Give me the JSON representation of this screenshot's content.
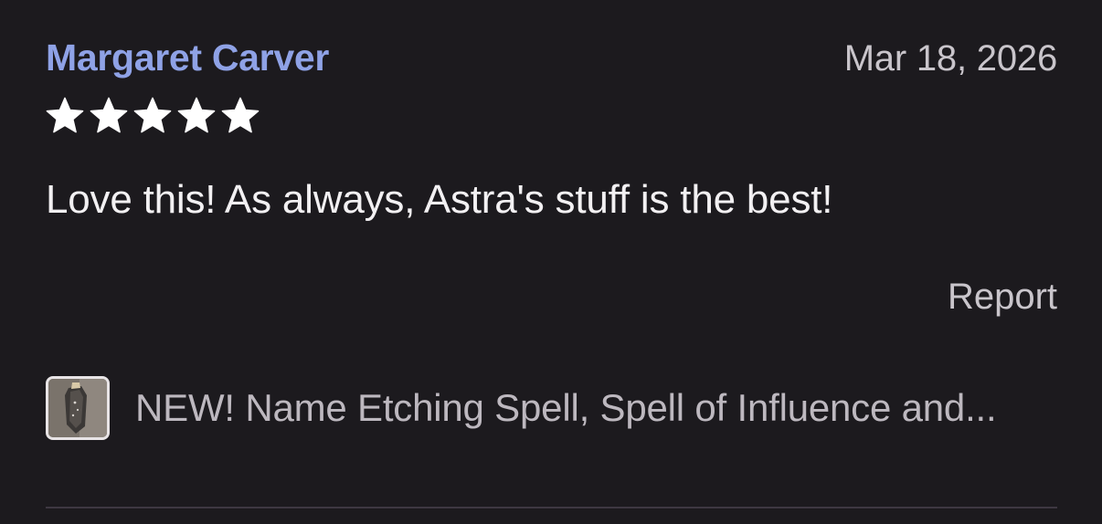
{
  "review": {
    "reviewer_name": "Margaret Carver",
    "date": "Mar 18, 2026",
    "rating": 5,
    "rating_max": 5,
    "body": "Love this! As always, Astra's stuff is the best!",
    "report_label": "Report"
  },
  "item": {
    "title": "NEW! Name Etching Spell, Spell of Influence and...",
    "thumbnail_icon": "pendant-product-thumbnail"
  },
  "colors": {
    "background": "#1c1a1e",
    "reviewer_name": "#8fa2e6",
    "muted_text": "#c9c5cb",
    "body_text": "#f2f0f2",
    "star": "#ffffff",
    "divider": "#3e3842"
  }
}
